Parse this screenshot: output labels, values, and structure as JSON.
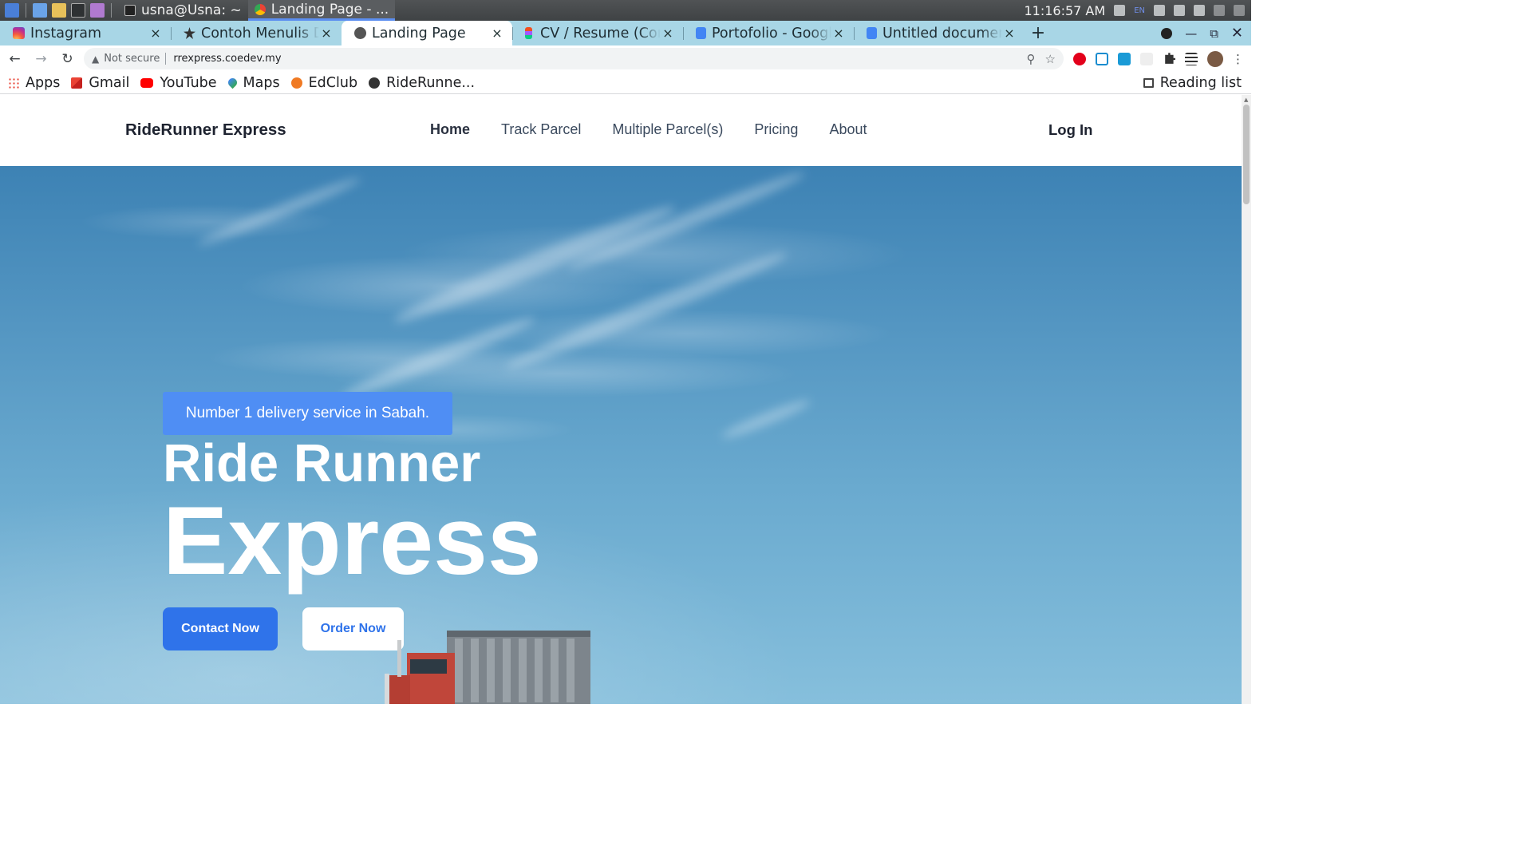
{
  "taskbar": {
    "tasks": [
      {
        "label": "usna@Usna: ~"
      },
      {
        "label": "Landing Page - ..."
      }
    ],
    "clock": "11:16:57 AM",
    "lang": "EN"
  },
  "tabs": [
    {
      "title": "Instagram",
      "close": "×"
    },
    {
      "title": "Contoh Menulis De",
      "close": "×"
    },
    {
      "title": "Landing Page",
      "close": "×"
    },
    {
      "title": "CV / Resume (Comr",
      "close": "×"
    },
    {
      "title": "Portofolio - Google",
      "close": "×"
    },
    {
      "title": "Untitled document",
      "close": "×"
    }
  ],
  "newtab_label": "+",
  "address": {
    "security": "Not secure",
    "url": "rrexpress.coedev.my"
  },
  "bookmarks": [
    {
      "label": "Apps"
    },
    {
      "label": "Gmail"
    },
    {
      "label": "YouTube"
    },
    {
      "label": "Maps"
    },
    {
      "label": "EdClub"
    },
    {
      "label": "RideRunne..."
    }
  ],
  "reading_list": "Reading list",
  "site": {
    "brand": "RideRunner Express",
    "nav": [
      "Home",
      "Track Parcel",
      "Multiple Parcel(s)",
      "Pricing",
      "About"
    ],
    "login": "Log In",
    "badge": "Number 1 delivery service in Sabah.",
    "heading_line1": "Ride Runner",
    "heading_line2": "Express",
    "contact_button": "Contact Now",
    "order_button": "Order Now"
  },
  "colors": {
    "accent": "#4f8ef4",
    "button_primary": "#2f73ea",
    "tabstrip": "#a8d6e6"
  }
}
